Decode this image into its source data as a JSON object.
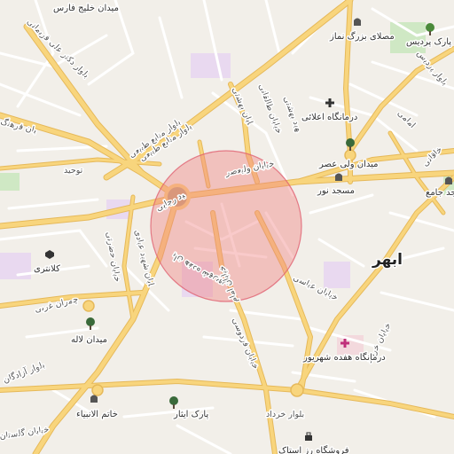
{
  "map": {
    "city_name": "ابهر",
    "search_circle": {
      "fill": "#f08080",
      "stroke": "#e06070"
    },
    "colors": {
      "background": "#f2efe9",
      "major_road": "#f8d57d",
      "major_road_casing": "#e6b95a",
      "minor_road": "#ffffff",
      "park": "#cfe8c4",
      "special_area": "#e9d9f0",
      "roundabout": "#c8a878"
    },
    "roads": [
      {
        "label": "بلوار منابع طبیعی"
      },
      {
        "label": "بلوار منابع طبیعی"
      },
      {
        "label": "بلوار دکتر علی فریمانی"
      },
      {
        "label": "توحید"
      },
      {
        "label": "خیابان ولیعصر"
      },
      {
        "label": "خیابان شهید رجایی"
      },
      {
        "label": "خیابان هفده شهریور"
      },
      {
        "label": "خیابان امام"
      },
      {
        "label": "خیابان بهشتی"
      },
      {
        "label": "خیابان طالقانی"
      },
      {
        "label": "خیابان شهید بهشتی"
      },
      {
        "label": "خیابان فردوسی"
      },
      {
        "label": "خیابان عباسی"
      },
      {
        "label": "خیابان خرداد"
      },
      {
        "label": "بلوار پردیس"
      },
      {
        "label": "خیابان حضرتی"
      },
      {
        "label": "خیابان شهید عبادی"
      },
      {
        "label": "چمران غربی"
      },
      {
        "label": "بلوار آزادگان"
      },
      {
        "label": "خیابان گلستان"
      },
      {
        "label": "امامی"
      },
      {
        "label": "خیابان فرهنگ"
      },
      {
        "label": "خاقانی"
      },
      {
        "label": "بلوار خرداد"
      }
    ],
    "pois": [
      {
        "label": "میدان خلیج فارس",
        "icon": "none"
      },
      {
        "label": "مصلای بزرگ نماز",
        "icon": "mosque-icon"
      },
      {
        "label": "پارک پردیس",
        "icon": "tree-icon"
      },
      {
        "label": "درمانگاه اعلائی",
        "icon": "hospital-cross-icon"
      },
      {
        "label": "میدان ولی عصر",
        "icon": "tree-icon"
      },
      {
        "label": "مسجد نور",
        "icon": "mosque-icon"
      },
      {
        "label": "مسجد جامع",
        "icon": "mosque-icon"
      },
      {
        "label": "کلانتری",
        "icon": "police-icon"
      },
      {
        "label": "میدان لاله",
        "icon": "tree-icon"
      },
      {
        "label": "درمانگاه هفده شهریور",
        "icon": "hospital-cross-icon"
      },
      {
        "label": "خاتم الانبیاء",
        "icon": "mosque-icon"
      },
      {
        "label": "پارک ایثار",
        "icon": "tree-icon"
      },
      {
        "label": "فروشگاه رز استاک",
        "icon": "shop-icon"
      }
    ]
  }
}
